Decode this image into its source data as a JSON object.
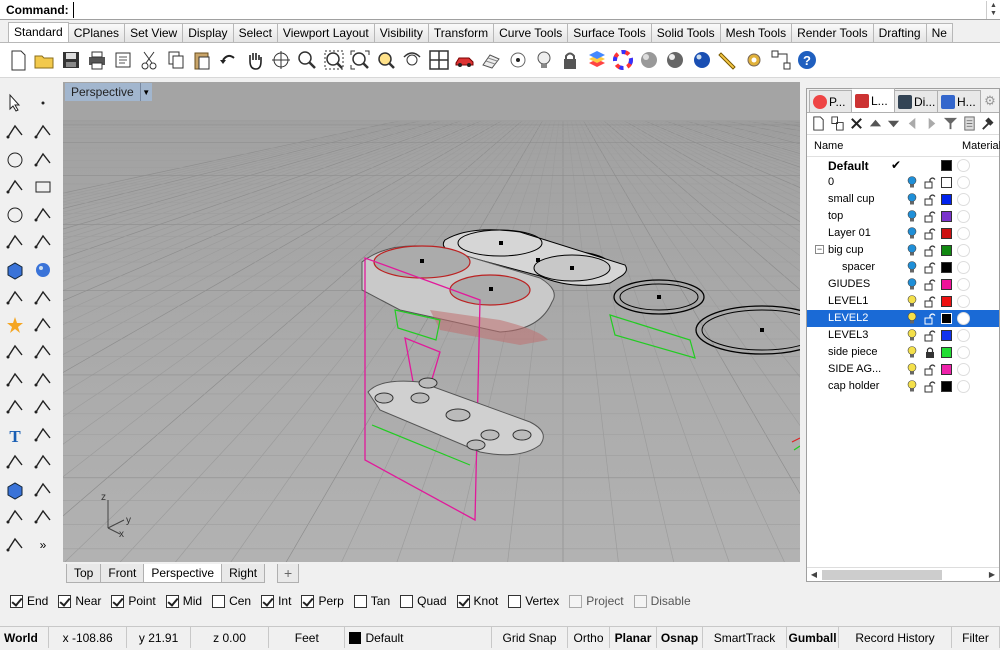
{
  "command": {
    "label": "Command:",
    "value": ""
  },
  "tabs": [
    "Standard",
    "CPlanes",
    "Set View",
    "Display",
    "Select",
    "Viewport Layout",
    "Visibility",
    "Transform",
    "Curve Tools",
    "Surface Tools",
    "Solid Tools",
    "Mesh Tools",
    "Render Tools",
    "Drafting",
    "Ne"
  ],
  "toolbar_icons": [
    "new-file-icon",
    "open-folder-icon",
    "save-icon",
    "print-icon",
    "import-icon",
    "cut-icon",
    "copy-icon",
    "paste-icon",
    "undo-icon",
    "pan-hand-icon",
    "rotate-view-icon",
    "zoom-icon",
    "zoom-window-icon",
    "zoom-extents-icon",
    "zoom-selected-icon",
    "rotate-camera-icon",
    "four-viewports-icon",
    "car-icon",
    "grid-options-icon",
    "point-icon",
    "light-bulb-icon",
    "lock-icon",
    "layer-icon",
    "color-wheel-icon",
    "material-sphere-icon",
    "render-sphere-icon",
    "blue-sphere-icon",
    "pen-icon",
    "gear-icon",
    "network-icon",
    "help-icon"
  ],
  "viewport": {
    "title": "Perspective",
    "axis_labels": {
      "z": "z",
      "y": "y",
      "x": "x"
    }
  },
  "viewport_tabs": [
    "Top",
    "Front",
    "Perspective",
    "Right"
  ],
  "right_panel": {
    "tabs": [
      "P...",
      "L...",
      "Di...",
      "H..."
    ],
    "columns": {
      "name": "Name",
      "material": "Material"
    },
    "layers": [
      {
        "name": "Default",
        "color": "#000000",
        "current": true
      },
      {
        "name": "0",
        "color": "#ffffff"
      },
      {
        "name": "small cup",
        "color": "#0022ee"
      },
      {
        "name": "top",
        "color": "#7a33cc"
      },
      {
        "name": "Layer 01",
        "color": "#cc1111"
      },
      {
        "name": "big cup",
        "color": "#118811",
        "expanded": true
      },
      {
        "name": "spacer",
        "color": "#000000",
        "sub": true
      },
      {
        "name": "GIUDES",
        "color": "#ee1199"
      },
      {
        "name": "LEVEL1",
        "color": "#ee1111"
      },
      {
        "name": "LEVEL2",
        "color": "#000000",
        "selected": true
      },
      {
        "name": "LEVEL3",
        "color": "#1133ee"
      },
      {
        "name": "side piece",
        "color": "#22dd33",
        "locked": true
      },
      {
        "name": "SIDE AG...",
        "color": "#ee22aa"
      },
      {
        "name": "cap holder",
        "color": "#000000"
      }
    ]
  },
  "osnaps": [
    {
      "label": "End",
      "checked": true
    },
    {
      "label": "Near",
      "checked": true
    },
    {
      "label": "Point",
      "checked": true
    },
    {
      "label": "Mid",
      "checked": true
    },
    {
      "label": "Cen",
      "checked": false
    },
    {
      "label": "Int",
      "checked": true
    },
    {
      "label": "Perp",
      "checked": true
    },
    {
      "label": "Tan",
      "checked": false
    },
    {
      "label": "Quad",
      "checked": false
    },
    {
      "label": "Knot",
      "checked": true
    },
    {
      "label": "Vertex",
      "checked": false
    },
    {
      "label": "Project",
      "checked": false,
      "disabled": true
    },
    {
      "label": "Disable",
      "checked": false,
      "disabled": true
    }
  ],
  "status": {
    "cplane": "World",
    "x": "x -108.86",
    "y": "y 21.91",
    "z": "z 0.00",
    "units": "Feet",
    "layer": "Default",
    "buttons": [
      {
        "label": "Grid Snap",
        "bold": false
      },
      {
        "label": "Ortho",
        "bold": false
      },
      {
        "label": "Planar",
        "bold": true
      },
      {
        "label": "Osnap",
        "bold": true
      },
      {
        "label": "SmartTrack",
        "bold": false
      },
      {
        "label": "Gumball",
        "bold": true
      },
      {
        "label": "Record History",
        "bold": false
      },
      {
        "label": "Filter",
        "bold": false
      }
    ]
  }
}
